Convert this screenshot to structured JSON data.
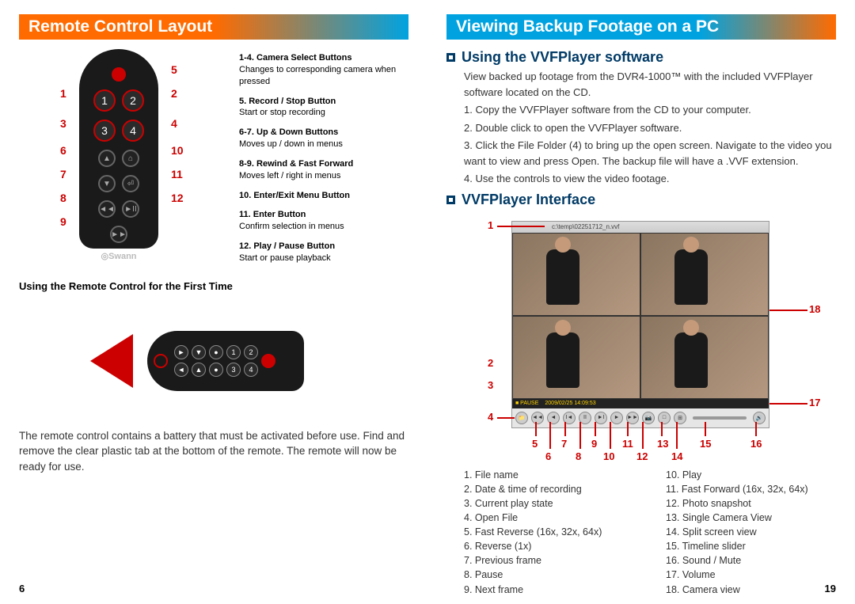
{
  "left": {
    "header": "Remote Control Layout",
    "callouts": {
      "c1": "1",
      "c2": "2",
      "c3": "3",
      "c4": "4",
      "c5": "5",
      "c6": "6",
      "c7": "7",
      "c8": "8",
      "c9": "9",
      "c10": "10",
      "c11": "11",
      "c12": "12"
    },
    "legend": [
      {
        "title": "1-4.  Camera Select Buttons",
        "desc": "Changes to corresponding camera when pressed"
      },
      {
        "title": "5.  Record / Stop Button",
        "desc": "Start or stop recording"
      },
      {
        "title": "6-7.  Up & Down Buttons",
        "desc": "Moves up / down in menus"
      },
      {
        "title": "8-9.  Rewind & Fast Forward",
        "desc": "Moves left / right in menus"
      },
      {
        "title": "10.  Enter/Exit Menu Button",
        "desc": ""
      },
      {
        "title": "11.  Enter Button",
        "desc": "Confirm selection in menus"
      },
      {
        "title": "12.  Play / Pause Button",
        "desc": "Start or pause playback"
      }
    ],
    "brand": "◎Swann",
    "subheading": "Using the Remote Control for the First Time",
    "body": "The remote control contains a battery that must be activated before use. Find and remove the clear plastic tab at the bottom of the remote.  The remote will now be ready for use.",
    "pagenum": "6"
  },
  "right": {
    "header": "Viewing Backup Footage on a PC",
    "sec1": "Using the VVFPlayer software",
    "intro": "View backed up footage from the DVR4-1000™ with the included VVFPlayer software located on the CD.",
    "steps": {
      "s1": "1.  Copy the VVFPlayer software from the CD to your computer.",
      "s2": "2.  Double click to open the VVFPlayer software.",
      "s3": "3.  Click the File Folder (4) to bring up the open screen.  Navigate to the video you want to view and press Open.  The backup file will have a .VVF extension.",
      "s4": "4.  Use the controls to view the video footage."
    },
    "sec2": "VVFPlayer Interface",
    "player_title": "c:\\temp\\02251712_n.vvf",
    "player_status_pause": "■ PAUSE",
    "player_status_time": "2009/02/25 14:09:53",
    "labels": {
      "l1": "1",
      "l2": "2",
      "l3": "3",
      "l4": "4",
      "l5": "5",
      "l6": "6",
      "l7": "7",
      "l8": "8",
      "l9": "9",
      "l10": "10",
      "l11": "11",
      "l12": "12",
      "l13": "13",
      "l14": "14",
      "l15": "15",
      "l16": "16",
      "l17": "17",
      "l18": "18"
    },
    "legendA": [
      "1.   File name",
      "2.   Date & time of recording",
      "3.   Current play state",
      "4.   Open File",
      "5.   Fast Reverse (16x, 32x, 64x)",
      "6.   Reverse (1x)",
      "7.   Previous frame",
      "8.   Pause",
      "9.   Next frame"
    ],
    "legendB": [
      "10.   Play",
      "11.   Fast Forward (16x, 32x, 64x)",
      "12.   Photo snapshot",
      "13.   Single Camera View",
      "14.   Split screen view",
      "15.   Timeline slider",
      "16.   Sound / Mute",
      "17.   Volume",
      "18.   Camera view"
    ],
    "pagenum": "19"
  }
}
